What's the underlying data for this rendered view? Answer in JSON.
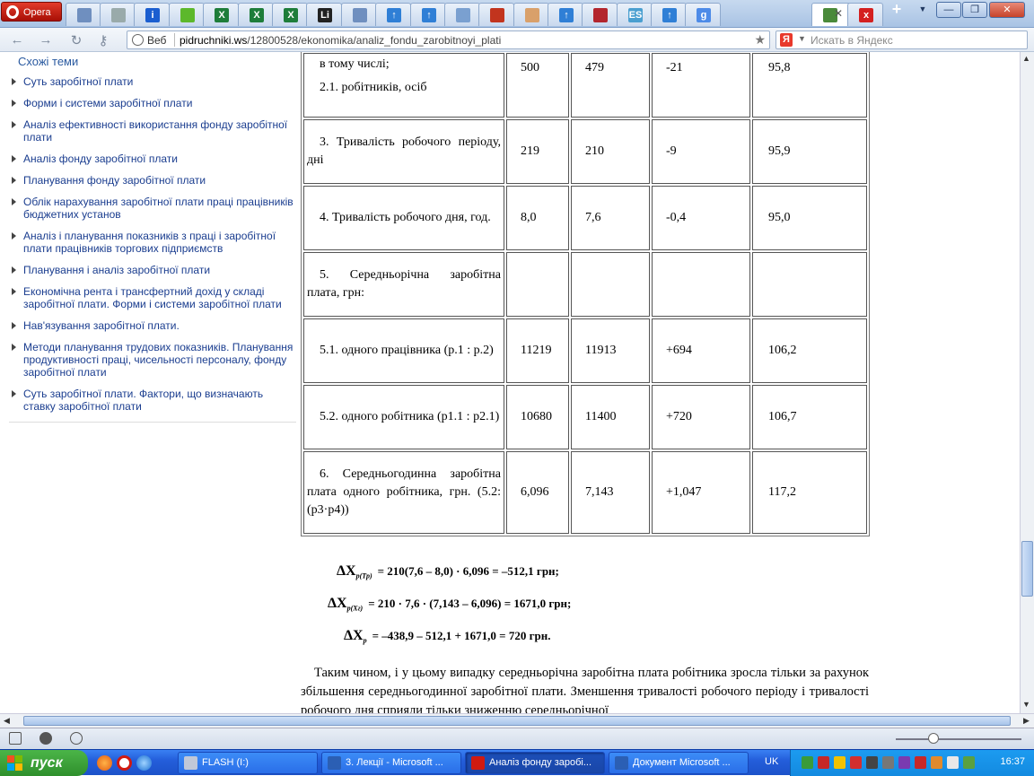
{
  "browser": {
    "menu_label": "Opera",
    "tabs": [
      {
        "icon": "page-icon",
        "color": "#6f8fbf"
      },
      {
        "icon": "doc-icon",
        "color": "#9aa"
      },
      {
        "icon": "info-icon",
        "color": "#1b5ed0",
        "glyph": "i"
      },
      {
        "icon": "apple-icon",
        "color": "#5cb82b"
      },
      {
        "icon": "excel-icon",
        "color": "#1e7d3a",
        "glyph": "X"
      },
      {
        "icon": "excel-icon",
        "color": "#1e7d3a",
        "glyph": "X"
      },
      {
        "icon": "excel-icon",
        "color": "#1e7d3a",
        "glyph": "X"
      },
      {
        "icon": "li-icon",
        "color": "#222",
        "glyph": "Li"
      },
      {
        "icon": "page-icon",
        "color": "#6f8fbf"
      },
      {
        "icon": "arrow-up-icon",
        "color": "#2f7fd6",
        "glyph": "↑"
      },
      {
        "icon": "arrow-up-icon",
        "color": "#2f7fd6",
        "glyph": "↑"
      },
      {
        "icon": "doc-icon",
        "color": "#7aa0d0"
      },
      {
        "icon": "book-icon",
        "color": "#c2341e"
      },
      {
        "icon": "chart-icon",
        "color": "#d9a06a"
      },
      {
        "icon": "arrow-up-icon",
        "color": "#2f7fd6",
        "glyph": "↑"
      },
      {
        "icon": "mail-icon",
        "color": "#b3262e"
      },
      {
        "icon": "es-icon",
        "color": "#4a9fd0",
        "glyph": "ES"
      },
      {
        "icon": "arrow-up-icon",
        "color": "#2f7fd6",
        "glyph": "↑"
      },
      {
        "icon": "google-icon",
        "color": "#4d8be8",
        "glyph": "g"
      },
      {
        "icon": "books-icon",
        "color": "#4a8a3a"
      },
      {
        "icon": "x-icon",
        "color": "#d42020",
        "glyph": "x"
      }
    ],
    "address": {
      "web_label": "Веб",
      "domain": "pidruchniki.ws",
      "path": "/12800528/ekonomika/analiz_fondu_zarobitnoyi_plati"
    },
    "search_placeholder": "Искать в Яндекс",
    "search_engine_glyph": "Я"
  },
  "sidebar": {
    "heading": "Схожі теми",
    "items": [
      "Суть заробітної плати",
      "Форми і системи заробітної плати",
      "Аналіз ефективності використання фонду заробітної плати",
      "Аналіз фонду заробітної плати",
      "Планування фонду заробітної плати",
      "Облік нарахування заробітної плати праці працівників бюджетних установ",
      "Аналіз і планування показників з праці і заробітної плати працівників торгових підприємств",
      "Планування і аналіз заробітної плати",
      "Економічна рента і трансфертний дохід у складі заробітної плати. Форми і системи заробітної плати",
      "Нав'язування заробітної плати.",
      "Методи планування трудових показників. Планування продуктивності праці, чисельності персоналу, фонду заробітної плати",
      "Суть заробітної плати. Фактори, що визначають ставку заробітної плати"
    ]
  },
  "table": {
    "rows": [
      {
        "label_lines": [
          "в тому числі;",
          "2.1. робітників, осіб"
        ],
        "v1": "500",
        "v2": "479",
        "v3": "-21",
        "v4": "95,8"
      },
      {
        "label": "3. Тривалість робочого періоду, дні",
        "v1": "219",
        "v2": "210",
        "v3": "-9",
        "v4": "95,9"
      },
      {
        "label": "4. Тривалість робочого дня, год.",
        "v1": "8,0",
        "v2": "7,6",
        "v3": "-0,4",
        "v4": "95,0"
      },
      {
        "label": "5. Середньорічна заробітна плата, грн:",
        "v1": "",
        "v2": "",
        "v3": "",
        "v4": ""
      },
      {
        "label": "5.1. одного працівника (р.1 : р.2)",
        "v1": "11219",
        "v2": "11913",
        "v3": "+694",
        "v4": "106,2"
      },
      {
        "label": "5.2. одного робітника (р1.1 : р2.1)",
        "v1": "10680",
        "v2": "11400",
        "v3": "+720",
        "v4": "106,7"
      },
      {
        "label": "6. Середньогодинна заробітна плата одного робітника, грн. (5.2:(р3·р4))",
        "v1": "6,096",
        "v2": "7,143",
        "v3": "+1,047",
        "v4": "117,2"
      }
    ]
  },
  "formulas": [
    {
      "symbol": "ΔX",
      "sub": "р(Тр)",
      "expr": "= 210(7,6 – 8,0) · 6,096 = –512,1 грн;"
    },
    {
      "symbol": "ΔX",
      "sub": "р(Хг)",
      "expr": "= 210 · 7,6 · (7,143 – 6,096) = 1671,0 грн;"
    },
    {
      "symbol": "ΔX",
      "sub": "р",
      "expr": "= –438,9 – 512,1 + 1671,0 = 720 грн."
    }
  ],
  "paragraph": "Таким чином, і у цьому випадку середньорічна заробітна плата робітника зросла тільки за рахунок збільшення середньогодинної заробітної плати. Зменшення тривалості робочого періоду і тривалості робочого дня сприяли тільки зниженню середньорічної",
  "taskbar": {
    "start_label": "пуск",
    "tasks": [
      {
        "label": "FLASH (I:)",
        "icon_color": "#c0c8d8",
        "active": false
      },
      {
        "label": "3. Лекції - Microsoft ...",
        "icon_color": "#2b5fb4",
        "active": false
      },
      {
        "label": "Аналіз фонду заробі...",
        "icon_color": "#d01a10",
        "active": true
      },
      {
        "label": "Документ Microsoft ...",
        "icon_color": "#2b5fb4",
        "active": false
      }
    ],
    "language": "UK",
    "clock": "16:37"
  }
}
